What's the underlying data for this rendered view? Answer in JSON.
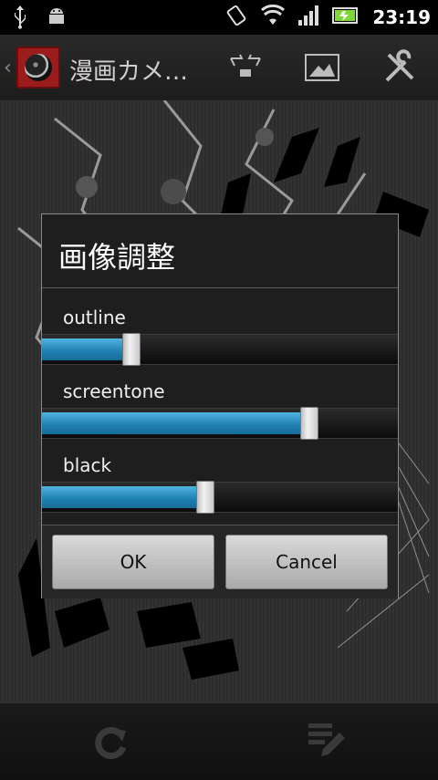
{
  "status_bar": {
    "time": "23:19",
    "icons": [
      "usb-icon",
      "android-debug-icon",
      "vibrate-icon",
      "wifi-icon",
      "signal-icon",
      "battery-icon"
    ]
  },
  "action_bar": {
    "title": "漫画カメ…",
    "actions": [
      "crop-icon",
      "gallery-icon",
      "settings-tools-icon"
    ]
  },
  "dialog": {
    "title": "画像調整",
    "sliders": [
      {
        "label": "outline",
        "value_percent": 25
      },
      {
        "label": "screentone",
        "value_percent": 75
      },
      {
        "label": "black",
        "value_percent": 46
      }
    ],
    "ok_label": "OK",
    "cancel_label": "Cancel"
  },
  "bottom_bar": {
    "actions": [
      "rotate-icon",
      "edit-notes-icon"
    ]
  },
  "colors": {
    "accent": "#1e8fc6",
    "dialog_bg": "#1e1e1e"
  }
}
